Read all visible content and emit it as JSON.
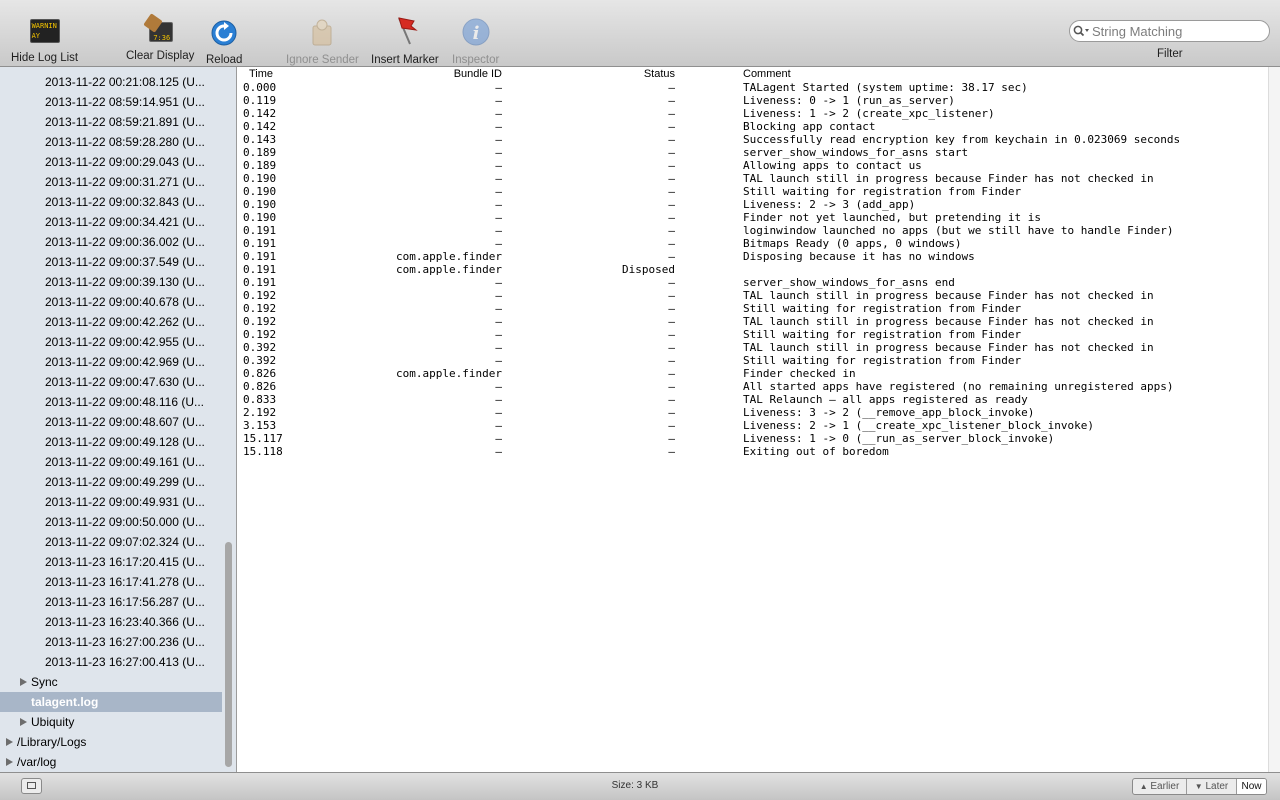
{
  "toolbar": {
    "hide_log_list": "Hide Log List",
    "clear_display": "Clear Display",
    "reload": "Reload",
    "ignore_sender": "Ignore Sender",
    "insert_marker": "Insert Marker",
    "inspector": "Inspector",
    "console_icon_text_1": "WARNIN",
    "console_icon_text_2": "AY 7:36",
    "clear_icon_text": "7:36",
    "search_placeholder": "String Matching",
    "filter_label": "Filter"
  },
  "sidebar": {
    "entries": [
      "2013-11-22 00:21:08.125 (U...",
      "2013-11-22 08:59:14.951 (U...",
      "2013-11-22 08:59:21.891 (U...",
      "2013-11-22 08:59:28.280 (U...",
      "2013-11-22 09:00:29.043 (U...",
      "2013-11-22 09:00:31.271 (U...",
      "2013-11-22 09:00:32.843 (U...",
      "2013-11-22 09:00:34.421 (U...",
      "2013-11-22 09:00:36.002 (U...",
      "2013-11-22 09:00:37.549 (U...",
      "2013-11-22 09:00:39.130 (U...",
      "2013-11-22 09:00:40.678 (U...",
      "2013-11-22 09:00:42.262 (U...",
      "2013-11-22 09:00:42.955 (U...",
      "2013-11-22 09:00:42.969 (U...",
      "2013-11-22 09:00:47.630 (U...",
      "2013-11-22 09:00:48.116 (U...",
      "2013-11-22 09:00:48.607 (U...",
      "2013-11-22 09:00:49.128 (U...",
      "2013-11-22 09:00:49.161 (U...",
      "2013-11-22 09:00:49.299 (U...",
      "2013-11-22 09:00:49.931 (U...",
      "2013-11-22 09:00:50.000 (U...",
      "2013-11-22 09:07:02.324 (U...",
      "2013-11-23 16:17:20.415 (U...",
      "2013-11-23 16:17:41.278 (U...",
      "2013-11-23 16:17:56.287 (U...",
      "2013-11-23 16:23:40.366 (U...",
      "2013-11-23 16:27:00.236 (U...",
      "2013-11-23 16:27:00.413 (U..."
    ],
    "sync": "Sync",
    "talagent": "talagent.log",
    "ubiquity": "Ubiquity",
    "library_logs": "/Library/Logs",
    "var_log": "/var/log"
  },
  "log": {
    "headers": {
      "time": "Time",
      "bundle": "Bundle ID",
      "status": "Status",
      "comment": "Comment"
    },
    "rows": [
      {
        "time": "0.000",
        "bundle": "–",
        "status": "–",
        "comment": "TALagent Started (system uptime: 38.17 sec)"
      },
      {
        "time": "0.119",
        "bundle": "–",
        "status": "–",
        "comment": "Liveness: 0 -> 1 (run_as_server)"
      },
      {
        "time": "0.142",
        "bundle": "–",
        "status": "–",
        "comment": "Liveness: 1 -> 2 (create_xpc_listener)"
      },
      {
        "time": "0.142",
        "bundle": "–",
        "status": "–",
        "comment": "Blocking app contact"
      },
      {
        "time": "0.143",
        "bundle": "–",
        "status": "–",
        "comment": "Successfully read encryption key from keychain in 0.023069 seconds"
      },
      {
        "time": "0.189",
        "bundle": "–",
        "status": "–",
        "comment": "server_show_windows_for_asns start"
      },
      {
        "time": "0.189",
        "bundle": "–",
        "status": "–",
        "comment": "Allowing apps to contact us"
      },
      {
        "time": "0.190",
        "bundle": "–",
        "status": "–",
        "comment": "TAL launch still in progress because Finder has not checked in"
      },
      {
        "time": "0.190",
        "bundle": "–",
        "status": "–",
        "comment": "Still waiting for registration from Finder"
      },
      {
        "time": "0.190",
        "bundle": "–",
        "status": "–",
        "comment": "Liveness: 2 -> 3 (add_app)"
      },
      {
        "time": "0.190",
        "bundle": "–",
        "status": "–",
        "comment": "Finder not yet launched, but pretending it is"
      },
      {
        "time": "0.191",
        "bundle": "–",
        "status": "–",
        "comment": "loginwindow launched no apps (but we still have to handle Finder)"
      },
      {
        "time": "0.191",
        "bundle": "–",
        "status": "–",
        "comment": "Bitmaps Ready (0 apps, 0 windows)"
      },
      {
        "time": "0.191",
        "bundle": "com.apple.finder",
        "status": "–",
        "comment": "Disposing because it has no windows"
      },
      {
        "time": "0.191",
        "bundle": "com.apple.finder",
        "status": "Disposed",
        "comment": ""
      },
      {
        "time": "0.191",
        "bundle": "–",
        "status": "–",
        "comment": "server_show_windows_for_asns end"
      },
      {
        "time": "0.192",
        "bundle": "–",
        "status": "–",
        "comment": "TAL launch still in progress because Finder has not checked in"
      },
      {
        "time": "0.192",
        "bundle": "–",
        "status": "–",
        "comment": "Still waiting for registration from Finder"
      },
      {
        "time": "0.192",
        "bundle": "–",
        "status": "–",
        "comment": "TAL launch still in progress because Finder has not checked in"
      },
      {
        "time": "0.192",
        "bundle": "–",
        "status": "–",
        "comment": "Still waiting for registration from Finder"
      },
      {
        "time": "0.392",
        "bundle": "–",
        "status": "–",
        "comment": "TAL launch still in progress because Finder has not checked in"
      },
      {
        "time": "0.392",
        "bundle": "–",
        "status": "–",
        "comment": "Still waiting for registration from Finder"
      },
      {
        "time": "0.826",
        "bundle": "com.apple.finder",
        "status": "–",
        "comment": "Finder checked in"
      },
      {
        "time": "0.826",
        "bundle": "–",
        "status": "–",
        "comment": "All started apps have registered (no remaining unregistered apps)"
      },
      {
        "time": "0.833",
        "bundle": "–",
        "status": "–",
        "comment": "TAL Relaunch – all apps registered as ready"
      },
      {
        "time": "2.192",
        "bundle": "–",
        "status": "–",
        "comment": "Liveness: 3 -> 2 (__remove_app_block_invoke)"
      },
      {
        "time": "3.153",
        "bundle": "–",
        "status": "–",
        "comment": "Liveness: 2 -> 1 (__create_xpc_listener_block_invoke)"
      },
      {
        "time": "15.117",
        "bundle": "–",
        "status": "–",
        "comment": "Liveness: 1 -> 0 (__run_as_server_block_invoke)"
      },
      {
        "time": "15.118",
        "bundle": "–",
        "status": "–",
        "comment": "Exiting out of boredom"
      }
    ]
  },
  "statusbar": {
    "size": "Size: 3 KB",
    "earlier": "Earlier",
    "later": "Later",
    "now": "Now"
  }
}
